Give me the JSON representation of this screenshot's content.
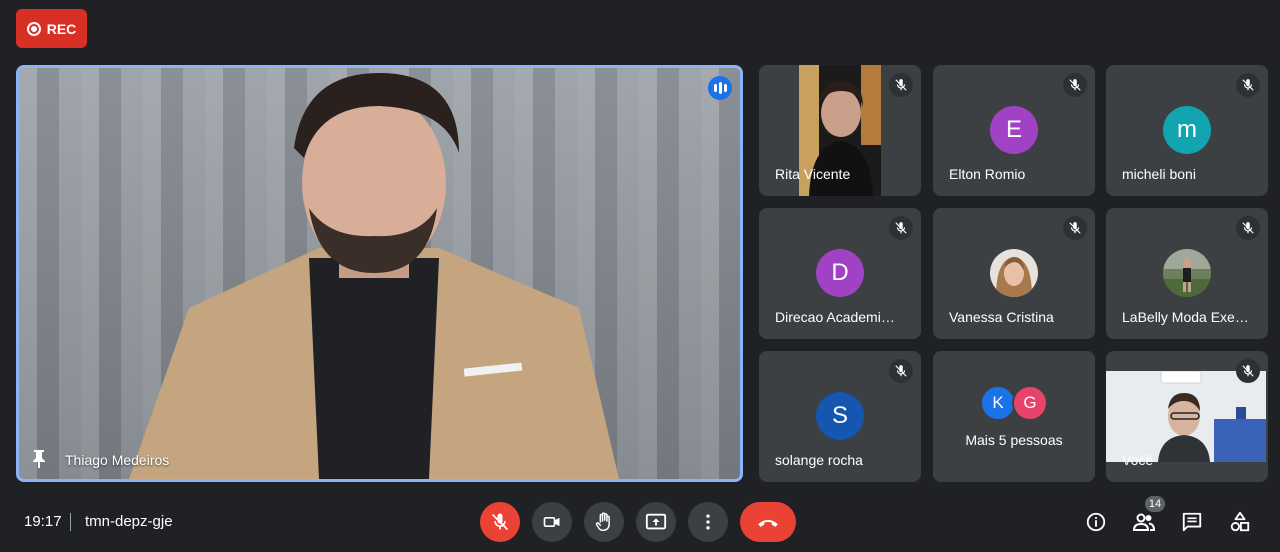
{
  "recording": {
    "label": "REC"
  },
  "main_speaker": {
    "name": "Thiago Medeiros"
  },
  "participants": [
    {
      "name": "Rita Vicente",
      "type": "video",
      "muted": true
    },
    {
      "name": "Elton Romio",
      "type": "avatar",
      "initial": "E",
      "color": "#a142c4",
      "muted": true
    },
    {
      "name": "micheli boni",
      "type": "avatar",
      "initial": "m",
      "color": "#12a4af",
      "muted": true
    },
    {
      "name": "Direcao Academi…",
      "type": "avatar",
      "initial": "D",
      "color": "#a142c4",
      "muted": true
    },
    {
      "name": "Vanessa Cristina",
      "type": "photo",
      "muted": true
    },
    {
      "name": "LaBelly Moda Exe…",
      "type": "photo",
      "muted": true
    },
    {
      "name": "solange rocha",
      "type": "avatar",
      "initial": "S",
      "color": "#1557b0",
      "muted": true
    },
    {
      "name": "Mais 5 pessoas",
      "type": "more",
      "initials": [
        "K",
        "G"
      ],
      "colors": [
        "#1a73e8",
        "#e8436b"
      ]
    },
    {
      "name": "Você",
      "type": "video",
      "muted": true
    }
  ],
  "meeting": {
    "time": "19:17",
    "code": "tmn-depz-gje"
  },
  "controls": {
    "icons": [
      "mic-off-icon",
      "camera-icon",
      "raise-hand-icon",
      "present-screen-icon",
      "more-options-icon",
      "hang-up-icon"
    ],
    "mic_color": "#ea4335",
    "hangup_color": "#ea4335"
  },
  "right_controls": {
    "participants_count": "14",
    "icons": [
      "info-icon",
      "people-icon",
      "chat-icon",
      "activities-icon"
    ]
  }
}
